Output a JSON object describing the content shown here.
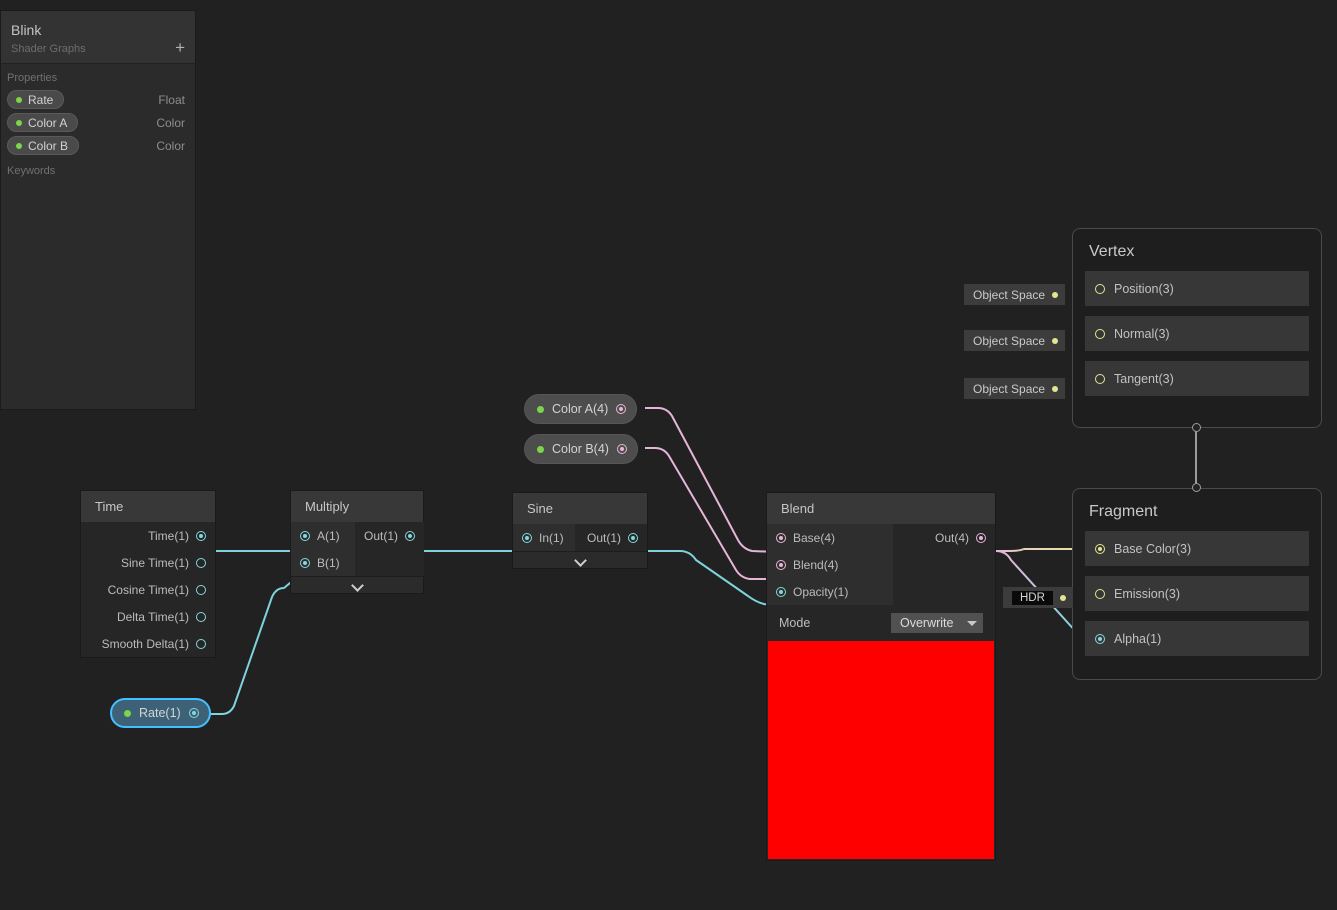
{
  "app": {
    "canvas_bg": "#212121",
    "accent_selected": "#44c0ff"
  },
  "blackboard": {
    "title": "Blink",
    "subtitle": "Shader Graphs",
    "add_label": "+",
    "properties_header": "Properties",
    "keywords_header": "Keywords",
    "properties": [
      {
        "name": "Rate",
        "type": "Float"
      },
      {
        "name": "Color A",
        "type": "Color"
      },
      {
        "name": "Color B",
        "type": "Color"
      }
    ]
  },
  "nodes": {
    "time": {
      "title": "Time",
      "outputs": [
        {
          "label": "Time(1)",
          "connected": true
        },
        {
          "label": "Sine Time(1)",
          "connected": false
        },
        {
          "label": "Cosine Time(1)",
          "connected": false
        },
        {
          "label": "Delta Time(1)",
          "connected": false
        },
        {
          "label": "Smooth Delta(1)",
          "connected": false
        }
      ]
    },
    "multiply": {
      "title": "Multiply",
      "inputs": [
        {
          "label": "A(1)",
          "connected": true
        },
        {
          "label": "B(1)",
          "connected": true
        }
      ],
      "outputs": [
        {
          "label": "Out(1)",
          "connected": true
        }
      ]
    },
    "sine": {
      "title": "Sine",
      "inputs": [
        {
          "label": "In(1)",
          "connected": true
        }
      ],
      "outputs": [
        {
          "label": "Out(1)",
          "connected": true
        }
      ]
    },
    "blend": {
      "title": "Blend",
      "inputs": [
        {
          "label": "Base(4)",
          "connected": true
        },
        {
          "label": "Blend(4)",
          "connected": true
        },
        {
          "label": "Opacity(1)",
          "connected": true
        }
      ],
      "outputs": [
        {
          "label": "Out(4)",
          "connected": true
        }
      ],
      "mode_label": "Mode",
      "mode_value": "Overwrite",
      "preview_color": "#ff0000"
    },
    "property_nodes": [
      {
        "label": "Color A(4)",
        "selected": false
      },
      {
        "label": "Color B(4)",
        "selected": false
      },
      {
        "label": "Rate(1)",
        "selected": true
      }
    ]
  },
  "vertex_stack": {
    "title": "Vertex",
    "blocks": [
      {
        "label": "Position(3)",
        "value": "Object Space"
      },
      {
        "label": "Normal(3)",
        "value": "Object Space"
      },
      {
        "label": "Tangent(3)",
        "value": "Object Space"
      }
    ]
  },
  "fragment_stack": {
    "title": "Fragment",
    "blocks": [
      {
        "label": "Base Color(3)",
        "value": ""
      },
      {
        "label": "Emission(3)",
        "value": "HDR"
      },
      {
        "label": "Alpha(1)",
        "value": ""
      }
    ]
  }
}
